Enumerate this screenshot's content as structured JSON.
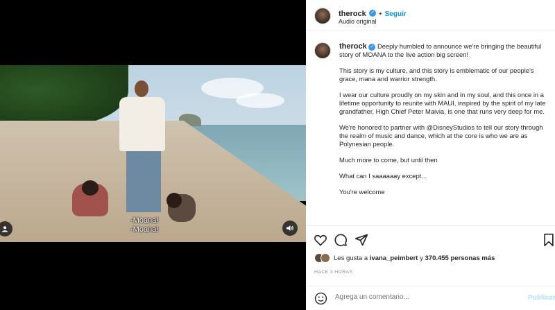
{
  "header": {
    "username": "therock",
    "separator": "•",
    "follow_label": "Seguir",
    "audio_label": "Audio original"
  },
  "video": {
    "subtitle_line1": "-Moana!",
    "subtitle_line2": "-Moana!"
  },
  "caption": {
    "username": "therock",
    "intro": "Deeply humbled to announce we're bringing the beautiful story of MOANA to the live action big screen!",
    "p1": "This story is my culture, and this story is emblematic of our people's grace, mana and warrior strength.",
    "p2": "I wear our culture proudly on my skin and in my soul, and this once in a lifetime opportunity to reunite with MAUI, inspired by the spirit of my late grandfather, High Chief Peter Maivia, is one that runs very deep for me.",
    "p3": "We're honored to partner with @DisneyStudios to tell our story through the realm of music and dance, which at the core is who we are as Polynesian people.",
    "p4": "Much more to come, but until then",
    "p5": "What can I saaaaaay except...",
    "p6": "You're welcome"
  },
  "likes": {
    "prefix": "Les gusta a",
    "user": "ivana_peimbert",
    "middle": "y",
    "count": "370.455",
    "suffix": "personas más"
  },
  "timestamp": "HACE 3 HORAS",
  "comment": {
    "placeholder": "Agrega un comentario...",
    "publish_label": "Publicar"
  },
  "icons": {
    "heart": "heart-icon",
    "comment": "comment-icon",
    "share": "share-icon",
    "bookmark": "bookmark-icon",
    "emoji": "emoji-icon",
    "user": "user-tag-icon",
    "sound": "sound-icon"
  },
  "colors": {
    "link": "#0095f6",
    "verified": "#3897f0",
    "publish_disabled": "#b2dffc"
  }
}
